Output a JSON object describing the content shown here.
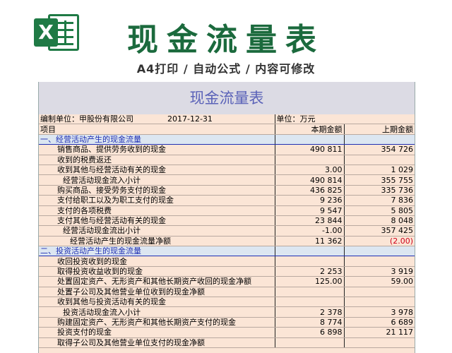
{
  "header": {
    "logo_letter": "X",
    "title": "现金流量表",
    "subtitle": "A4打印 / 自动公式 / 内容可修改"
  },
  "sheet": {
    "title": "现金流量表",
    "company": "编制单位：甲股份有限公司",
    "date": "2017-12-31",
    "unit": "单位：万元",
    "col_item": "项目",
    "col_current": "本期金额",
    "col_previous": "上期金额"
  },
  "rows": [
    {
      "label": "一、经营活动产生的现金流量",
      "cur": "",
      "prev": "",
      "kind": "section"
    },
    {
      "label": "销售商品、提供劳务收到的现金",
      "cur": "490 811",
      "prev": "354 726",
      "kind": "ind1"
    },
    {
      "label": "收到的税费返还",
      "cur": "",
      "prev": "",
      "kind": "ind1"
    },
    {
      "label": "收到其他与经营活动有关的现金",
      "cur": "3.00",
      "prev": "1 029",
      "kind": "ind1"
    },
    {
      "label": "经营活动现金流入小计",
      "cur": "490 814",
      "prev": "355 755",
      "kind": "ind2"
    },
    {
      "label": "购买商品、接受劳务支付的现金",
      "cur": "436 825",
      "prev": "335 736",
      "kind": "ind1"
    },
    {
      "label": "支付给职工以及为职工支付的现金",
      "cur": "9 236",
      "prev": "7 836",
      "kind": "ind1"
    },
    {
      "label": "支付的各项税费",
      "cur": "9 547",
      "prev": "5 805",
      "kind": "ind1"
    },
    {
      "label": "支付其他与经营活动有关的现金",
      "cur": "23 844",
      "prev": "8 048",
      "kind": "ind1"
    },
    {
      "label": "经营活动现金流出小计",
      "cur": "-1.00",
      "prev": "357 425",
      "kind": "ind2"
    },
    {
      "label": "经营活动产生的现金流量净额",
      "cur": "11 362",
      "prev": "(2.00)",
      "kind": "ind3",
      "prev_red": true
    },
    {
      "label": "二、投资活动产生的现金流量",
      "cur": "",
      "prev": "",
      "kind": "section"
    },
    {
      "label": "收回投资收到的现金",
      "cur": "",
      "prev": "",
      "kind": "ind1"
    },
    {
      "label": "取得投资收益收到的现金",
      "cur": "2 253",
      "prev": "3 919",
      "kind": "ind1"
    },
    {
      "label": "处置固定资产、无形资产和其他长期资产收回的现金净额",
      "cur": "125.00",
      "prev": "59.00",
      "kind": "ind1"
    },
    {
      "label": "处置子公司及其他营业单位收到的现金净额",
      "cur": "",
      "prev": "",
      "kind": "ind1"
    },
    {
      "label": "收到其他与投资活动有关的现金",
      "cur": "",
      "prev": "",
      "kind": "ind1"
    },
    {
      "label": "投资活动现金流入小计",
      "cur": "2 378",
      "prev": "3 978",
      "kind": "ind2"
    },
    {
      "label": "购建固定资产、无形资产和其他长期资产支付的现金",
      "cur": "8 774",
      "prev": "6 689",
      "kind": "ind1"
    },
    {
      "label": "投资支付的现金",
      "cur": "6 898",
      "prev": "21 117",
      "kind": "ind1"
    },
    {
      "label": "取得子公司及其他营业单位支付的现金净额",
      "cur": "",
      "prev": "",
      "kind": "ind1"
    }
  ],
  "colors": {
    "brand_green": "#1b6a3d",
    "sheet_bg": "#fbe5d6",
    "section_bg": "#dce6f1",
    "section_text": "#1f2fb3",
    "negative": "#d0021b"
  }
}
